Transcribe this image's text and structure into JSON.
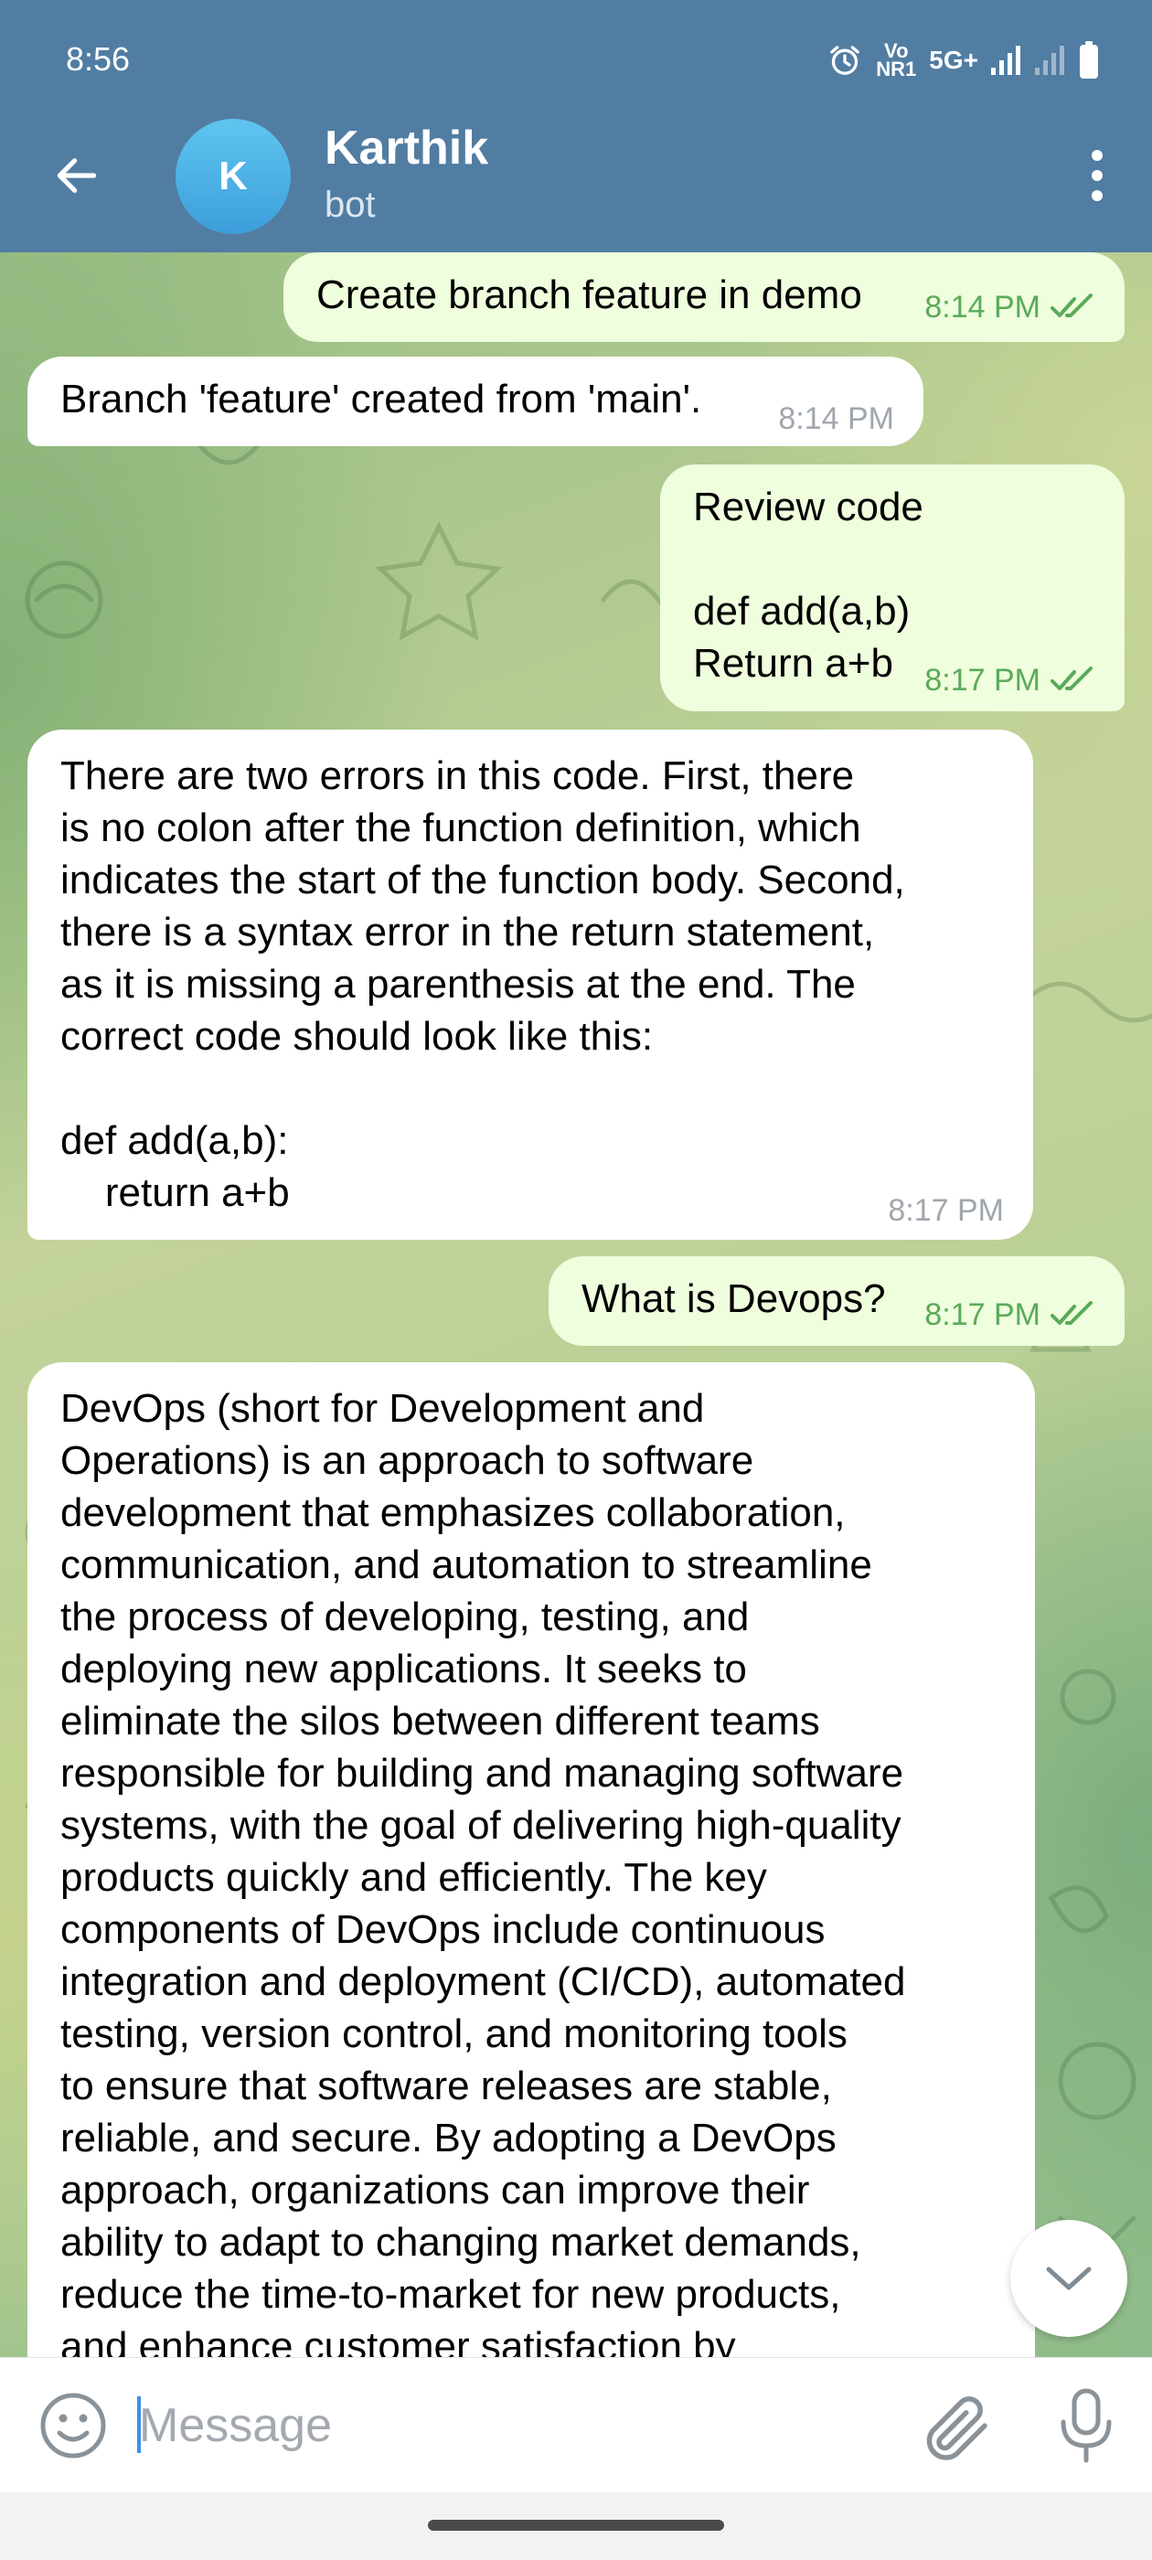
{
  "status_bar": {
    "time": "8:56",
    "vo_label": "Vo",
    "nr_label": "NR1",
    "network": "5G+"
  },
  "header": {
    "avatar_letter": "K",
    "title": "Karthik",
    "subtitle": "bot"
  },
  "messages": [
    {
      "direction": "outgoing",
      "text": "Create branch feature in demo",
      "time": "8:14 PM",
      "status": "read"
    },
    {
      "direction": "incoming",
      "text": "Branch 'feature' created from 'main'.",
      "time": "8:14 PM"
    },
    {
      "direction": "outgoing",
      "text": "Review code\n\ndef add(a,b)\nReturn a+b",
      "time": "8:17 PM",
      "status": "read"
    },
    {
      "direction": "incoming",
      "text": "There are two errors in this code. First, there\nis no colon after the function definition, which\nindicates the start of the function body. Second,\nthere is a syntax error in the return statement,\nas it is missing a parenthesis at the end. The\ncorrect code should look like this:\n\ndef add(a,b):\n    return a+b",
      "time": "8:17 PM"
    },
    {
      "direction": "outgoing",
      "text": "What is Devops?",
      "time": "8:17 PM",
      "status": "read"
    },
    {
      "direction": "incoming",
      "text": "DevOps (short for Development and\nOperations) is an approach to software\ndevelopment that emphasizes collaboration,\ncommunication, and automation to streamline\nthe process of developing, testing, and\ndeploying new applications. It seeks to\neliminate the silos between different teams\nresponsible for building and managing software\nsystems, with the goal of delivering high-quality\nproducts quickly and efficiently. The key\ncomponents of DevOps include continuous\nintegration and deployment (CI/CD), automated\ntesting, version control, and monitoring tools\nto ensure that software releases are stable,\nreliable, and secure. By adopting a DevOps\napproach, organizations can improve their\nability to adapt to changing market demands,\nreduce the time-to-market for new products,\nand enhance customer satisfaction by",
      "time": ""
    }
  ],
  "input": {
    "placeholder": "Message",
    "value": ""
  },
  "colors": {
    "header": "#517da2",
    "outgoing_bubble": "#effedd",
    "incoming_bubble": "#ffffff",
    "outgoing_meta": "#5aaa5a",
    "incoming_meta": "#a0a6ad"
  },
  "icons": {
    "back": "arrow-left-icon",
    "menu": "more-vertical-icon",
    "emoji": "smiley-icon",
    "attach": "paperclip-icon",
    "mic": "microphone-icon",
    "scroll": "chevron-down-icon",
    "read_status": "double-check-icon"
  }
}
